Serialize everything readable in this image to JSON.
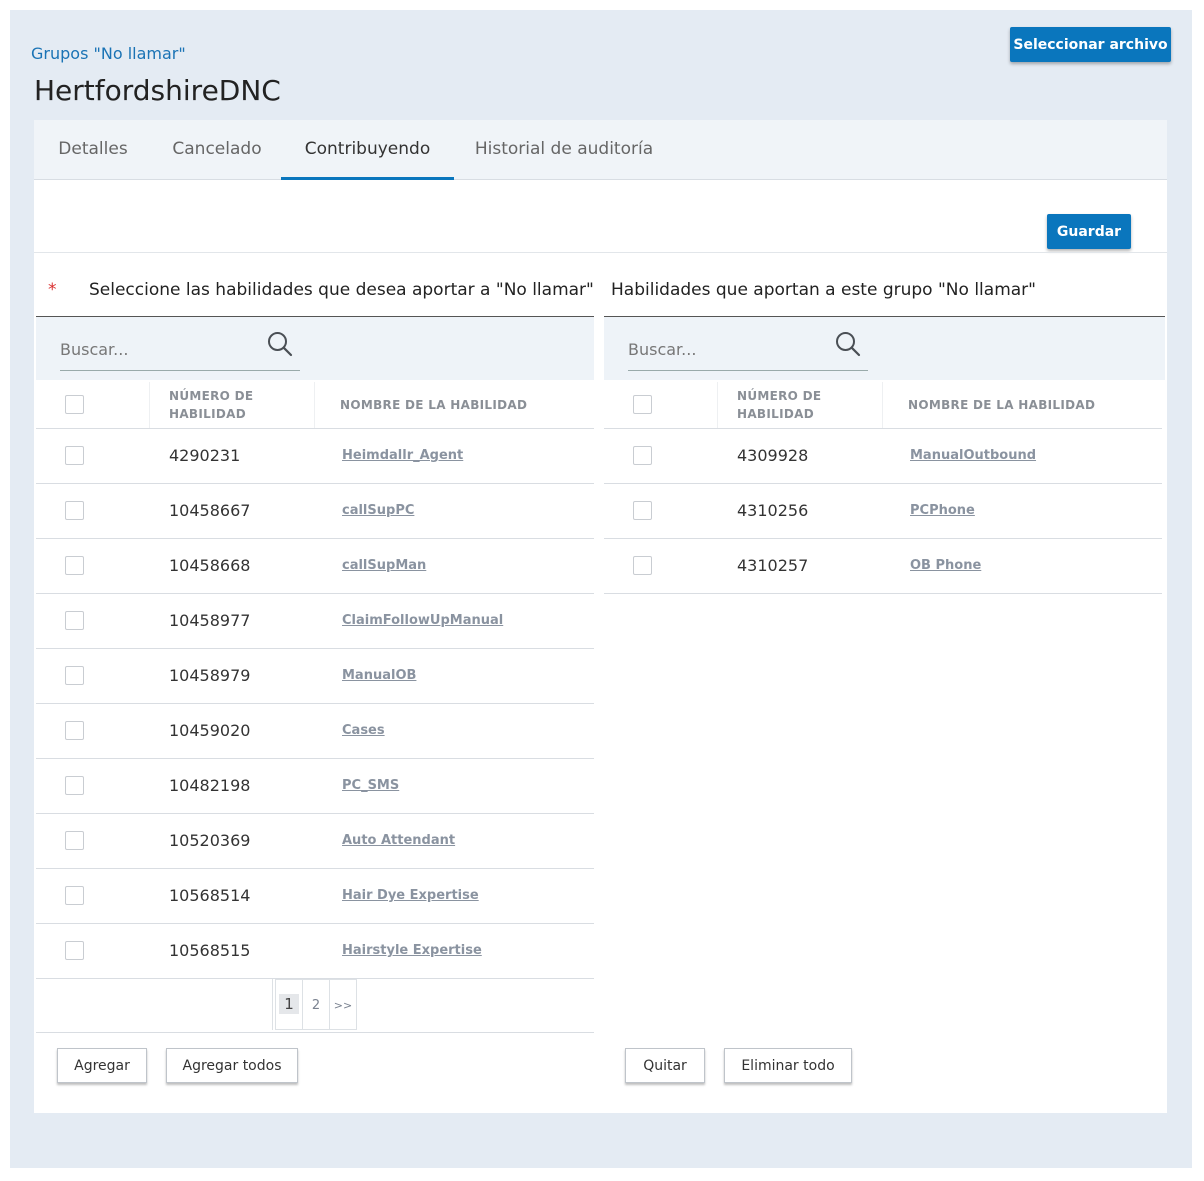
{
  "breadcrumb": "Grupos \"No llamar\"",
  "page_title": "HertfordshireDNC",
  "select_file_label": "Seleccionar archivo",
  "save_label": "Guardar",
  "tabs": [
    "Detalles",
    "Cancelado",
    "Contribuyendo",
    "Historial de auditoría"
  ],
  "active_tab": "Contribuyendo",
  "left": {
    "title": "Seleccione las habilidades que desea aportar a \"No llamar\"",
    "search_placeholder": "Buscar...",
    "col_number": "NÚMERO DE HABILIDAD",
    "col_number_l1": "NÚMERO DE",
    "col_number_l2": "HABILIDAD",
    "col_name": "NOMBRE DE LA HABILIDAD",
    "rows": [
      {
        "number": "4290231",
        "name": "Heimdallr_Agent"
      },
      {
        "number": "10458667",
        "name": "callSupPC"
      },
      {
        "number": "10458668",
        "name": "callSupMan"
      },
      {
        "number": "10458977",
        "name": "ClaimFollowUpManual"
      },
      {
        "number": "10458979",
        "name": "ManualOB"
      },
      {
        "number": "10459020",
        "name": "Cases"
      },
      {
        "number": "10482198",
        "name": "PC_SMS"
      },
      {
        "number": "10520369",
        "name": "Auto Attendant"
      },
      {
        "number": "10568514",
        "name": "Hair Dye Expertise"
      },
      {
        "number": "10568515",
        "name": "Hairstyle Expertise"
      }
    ],
    "pagination": {
      "current": "1",
      "next_page": "2",
      "next_label": ">>"
    },
    "add_label": "Agregar",
    "add_all_label": "Agregar todos"
  },
  "right": {
    "title": "Habilidades que aportan a este grupo \"No llamar\"",
    "search_placeholder": "Buscar...",
    "col_number_l1": "NÚMERO DE",
    "col_number_l2": "HABILIDAD",
    "col_name": "NOMBRE DE LA HABILIDAD",
    "rows": [
      {
        "number": "4309928",
        "name": "ManualOutbound"
      },
      {
        "number": "4310256",
        "name": "PCPhone"
      },
      {
        "number": "4310257",
        "name": "OB Phone"
      }
    ],
    "remove_label": "Quitar",
    "remove_all_label": "Eliminar todo"
  }
}
